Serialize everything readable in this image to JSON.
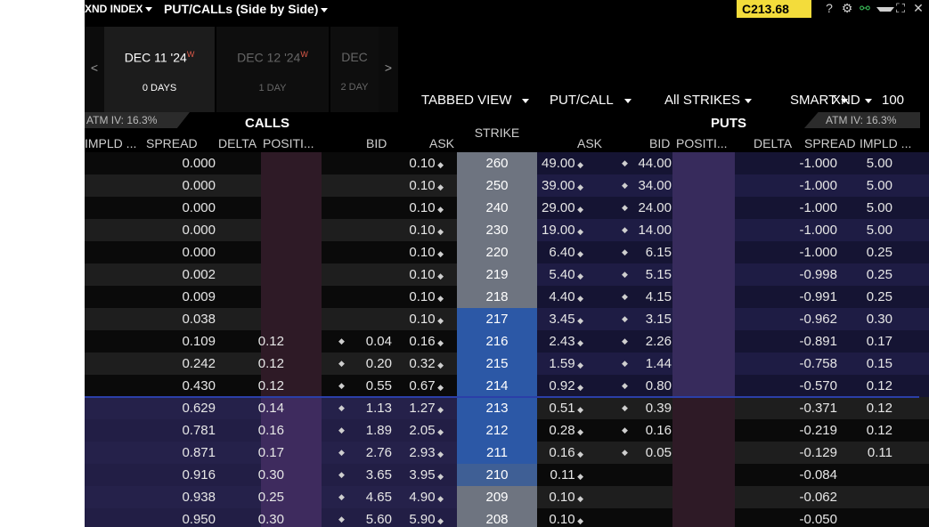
{
  "titlebar": {
    "symbol": "XND INDEX",
    "title": "PUT/CALLs (Side by Side)",
    "price": "C213.68",
    "icons": [
      "help-icon",
      "gear-icon",
      "link-icon",
      "chevron-down-icon",
      "maximize-icon",
      "close-icon"
    ],
    "help_glyph": "?",
    "gear_glyph": "⚙",
    "link_glyph": "🔗",
    "max_glyph": "⛶",
    "close_glyph": "✕"
  },
  "expiries": {
    "prev_glyph": "<",
    "next_glyph": ">",
    "items": [
      {
        "date": "DEC 11 '24",
        "weekly": "W",
        "days": "0 DAYS"
      },
      {
        "date": "DEC 12 '24",
        "weekly": "W",
        "days": "1 DAY"
      },
      {
        "date": "DEC",
        "weekly": "",
        "days": "2 DAY"
      }
    ]
  },
  "controls": {
    "view": "TABBED VIEW",
    "mode": "PUT/CALL",
    "strikes": "All STRIKES",
    "exchange": "SMART",
    "trading_class": "XND",
    "quantity": "100"
  },
  "header": {
    "atm_iv_calls": "ATM IV: 16.3%",
    "atm_iv_puts": "ATM IV: 16.3%",
    "calls": "CALLS",
    "puts": "PUTS",
    "strike": "STRIKE",
    "call_cols": [
      "IMPLD ...",
      "SPREAD",
      "DELTA",
      "POSITI...",
      "BID",
      "ASK"
    ],
    "put_cols": [
      "ASK",
      "BID",
      "POSITI...",
      "DELTA",
      "SPREAD",
      "IMPLD ..."
    ]
  },
  "colors": {
    "title_price_bg": "#f3dc3b",
    "itm_put_bg": "#1b1a3c",
    "itm_call_bg": "#25214a",
    "otm_bg": "#151515",
    "strike_bg": "#6e7480",
    "strike_atm_bg": "#2c58a6",
    "atm_line": "#2b3fa8"
  },
  "rows": [
    {
      "strike": "260",
      "c_spread": "",
      "c_delta": "0.000",
      "c_bid": "",
      "c_ask": "0.10",
      "p_ask": "49.00",
      "p_bid": "44.00",
      "p_delta": "-1.000",
      "p_spread": "5.00"
    },
    {
      "strike": "250",
      "c_spread": "",
      "c_delta": "0.000",
      "c_bid": "",
      "c_ask": "0.10",
      "p_ask": "39.00",
      "p_bid": "34.00",
      "p_delta": "-1.000",
      "p_spread": "5.00"
    },
    {
      "strike": "240",
      "c_spread": "",
      "c_delta": "0.000",
      "c_bid": "",
      "c_ask": "0.10",
      "p_ask": "29.00",
      "p_bid": "24.00",
      "p_delta": "-1.000",
      "p_spread": "5.00"
    },
    {
      "strike": "230",
      "c_spread": "",
      "c_delta": "0.000",
      "c_bid": "",
      "c_ask": "0.10",
      "p_ask": "19.00",
      "p_bid": "14.00",
      "p_delta": "-1.000",
      "p_spread": "5.00"
    },
    {
      "strike": "220",
      "c_spread": "",
      "c_delta": "0.000",
      "c_bid": "",
      "c_ask": "0.10",
      "p_ask": "6.40",
      "p_bid": "6.15",
      "p_delta": "-1.000",
      "p_spread": "0.25"
    },
    {
      "strike": "219",
      "c_spread": "",
      "c_delta": "0.002",
      "c_bid": "",
      "c_ask": "0.10",
      "p_ask": "5.40",
      "p_bid": "5.15",
      "p_delta": "-0.998",
      "p_spread": "0.25"
    },
    {
      "strike": "218",
      "c_spread": "",
      "c_delta": "0.009",
      "c_bid": "",
      "c_ask": "0.10",
      "p_ask": "4.40",
      "p_bid": "4.15",
      "p_delta": "-0.991",
      "p_spread": "0.25"
    },
    {
      "strike": "217",
      "c_spread": "",
      "c_delta": "0.038",
      "c_bid": "",
      "c_ask": "0.10",
      "p_ask": "3.45",
      "p_bid": "3.15",
      "p_delta": "-0.962",
      "p_spread": "0.30"
    },
    {
      "strike": "216",
      "c_spread": "0.12",
      "c_delta": "0.109",
      "c_bid": "0.04",
      "c_ask": "0.16",
      "p_ask": "2.43",
      "p_bid": "2.26",
      "p_delta": "-0.891",
      "p_spread": "0.17"
    },
    {
      "strike": "215",
      "c_spread": "0.12",
      "c_delta": "0.242",
      "c_bid": "0.20",
      "c_ask": "0.32",
      "p_ask": "1.59",
      "p_bid": "1.44",
      "p_delta": "-0.758",
      "p_spread": "0.15"
    },
    {
      "strike": "214",
      "c_spread": "0.12",
      "c_delta": "0.430",
      "c_bid": "0.55",
      "c_ask": "0.67",
      "p_ask": "0.92",
      "p_bid": "0.80",
      "p_delta": "-0.570",
      "p_spread": "0.12"
    },
    {
      "strike": "213",
      "c_spread": "0.14",
      "c_delta": "0.629",
      "c_bid": "1.13",
      "c_ask": "1.27",
      "p_ask": "0.51",
      "p_bid": "0.39",
      "p_delta": "-0.371",
      "p_spread": "0.12"
    },
    {
      "strike": "212",
      "c_spread": "0.16",
      "c_delta": "0.781",
      "c_bid": "1.89",
      "c_ask": "2.05",
      "p_ask": "0.28",
      "p_bid": "0.16",
      "p_delta": "-0.219",
      "p_spread": "0.12"
    },
    {
      "strike": "211",
      "c_spread": "0.17",
      "c_delta": "0.871",
      "c_bid": "2.76",
      "c_ask": "2.93",
      "p_ask": "0.16",
      "p_bid": "0.05",
      "p_delta": "-0.129",
      "p_spread": "0.11"
    },
    {
      "strike": "210",
      "c_spread": "0.30",
      "c_delta": "0.916",
      "c_bid": "3.65",
      "c_ask": "3.95",
      "p_ask": "0.11",
      "p_bid": "",
      "p_delta": "-0.084",
      "p_spread": ""
    },
    {
      "strike": "209",
      "c_spread": "0.25",
      "c_delta": "0.938",
      "c_bid": "4.65",
      "c_ask": "4.90",
      "p_ask": "0.10",
      "p_bid": "",
      "p_delta": "-0.062",
      "p_spread": ""
    },
    {
      "strike": "208",
      "c_spread": "0.30",
      "c_delta": "0.950",
      "c_bid": "5.60",
      "c_ask": "5.90",
      "p_ask": "0.10",
      "p_bid": "",
      "p_delta": "-0.050",
      "p_spread": ""
    }
  ]
}
